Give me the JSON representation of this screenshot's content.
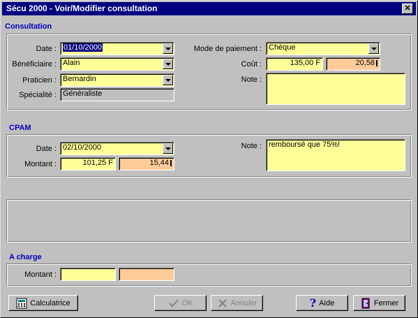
{
  "window": {
    "title": "Sécu 2000 - Voir/Modifier consultation",
    "close": "✕"
  },
  "consultation": {
    "section_title": "Consultation",
    "date_label": "Date :",
    "date_value": "01/10/2000",
    "beneficiaire_label": "Bénéficiaire :",
    "beneficiaire_value": "Alain",
    "praticien_label": "Praticien :",
    "praticien_value": "Bernardin",
    "specialite_label": "Spécialité :",
    "specialite_value": "Généraliste",
    "paiement_label": "Mode de paiement :",
    "paiement_value": "Chèque",
    "cout_label": "Coût :",
    "cout_francs": "135,00 F",
    "cout_euros": "20,58",
    "note_label": "Note :",
    "note_value": ""
  },
  "cpam": {
    "section_title": "CPAM",
    "date_label": "Date :",
    "date_value": "02/10/2000",
    "montant_label": "Montant :",
    "montant_francs": "101,25 F",
    "montant_euros": "15,44",
    "note_label": "Note :",
    "note_value": "remboursé que 75%!"
  },
  "a_charge": {
    "section_title": "A charge",
    "montant_label": "Montant :",
    "montant_francs": "",
    "montant_euros": ""
  },
  "buttons": {
    "calculatrice": "Calculatrice",
    "ok": "OK",
    "annuler": "Annuler",
    "aide": "Aide",
    "fermer": "Fermer"
  }
}
